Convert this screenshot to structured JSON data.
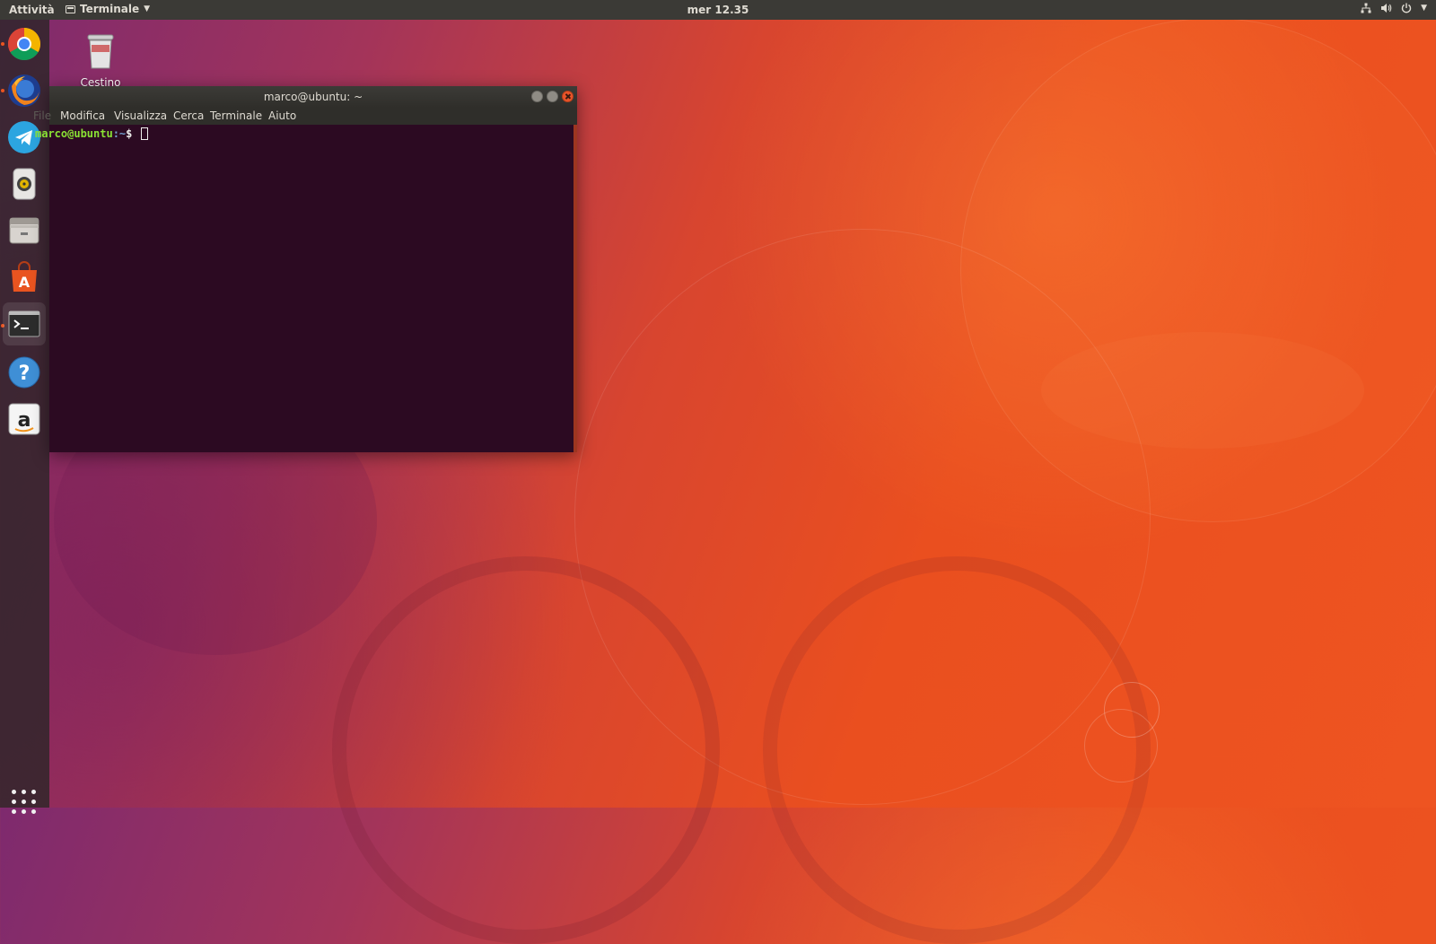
{
  "topbar": {
    "activities": "Attività",
    "app_menu": "Terminale",
    "clock": "mer 12.35"
  },
  "desktop": {
    "trash_label": "Cestino"
  },
  "dock": {
    "items": [
      "Chrome",
      "Firefox",
      "Telegram",
      "Rhythmbox",
      "Files",
      "Ubuntu Software",
      "Terminal",
      "Help",
      "Amazon"
    ],
    "active": "Terminal"
  },
  "terminal": {
    "title": "marco@ubuntu: ~",
    "menu": [
      "File",
      "Modifica",
      "Visualizza",
      "Cerca",
      "Terminale",
      "Aiuto"
    ],
    "prompt_user_host": "marco@ubuntu",
    "prompt_path": ":~",
    "prompt_symbol": "$ "
  },
  "colors": {
    "accent": "#e95420",
    "terminal_bg": "#2c0a22",
    "prompt_green": "#8ae234",
    "prompt_blue": "#729fcf"
  }
}
